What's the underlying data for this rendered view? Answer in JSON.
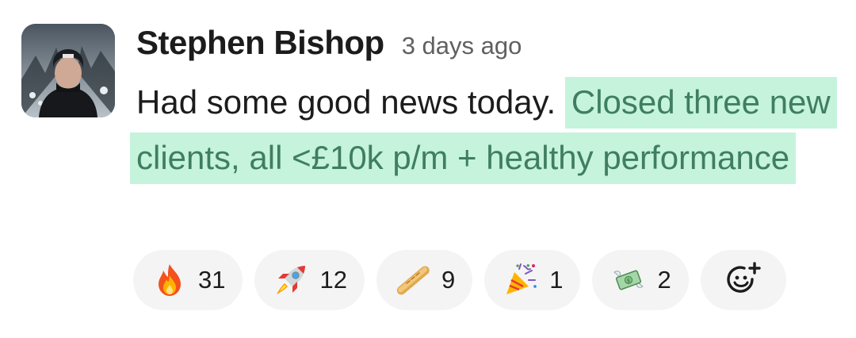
{
  "message": {
    "author": "Stephen Bishop",
    "timestamp": "3 days ago",
    "text_plain": "Had some good news today.",
    "text_highlighted": "Closed three new clients, all <£10k p/m + healthy performance"
  },
  "reactions": [
    {
      "icon": "fire-icon",
      "count": "31"
    },
    {
      "icon": "rocket-icon",
      "count": "12"
    },
    {
      "icon": "baguette-icon",
      "count": "9"
    },
    {
      "icon": "party-popper-icon",
      "count": "1"
    },
    {
      "icon": "money-with-wings-icon",
      "count": "2"
    }
  ],
  "colors": {
    "highlight_bg": "#c5f3dc",
    "highlight_text": "#3f7e5e",
    "pill_bg": "#f4f4f4"
  }
}
